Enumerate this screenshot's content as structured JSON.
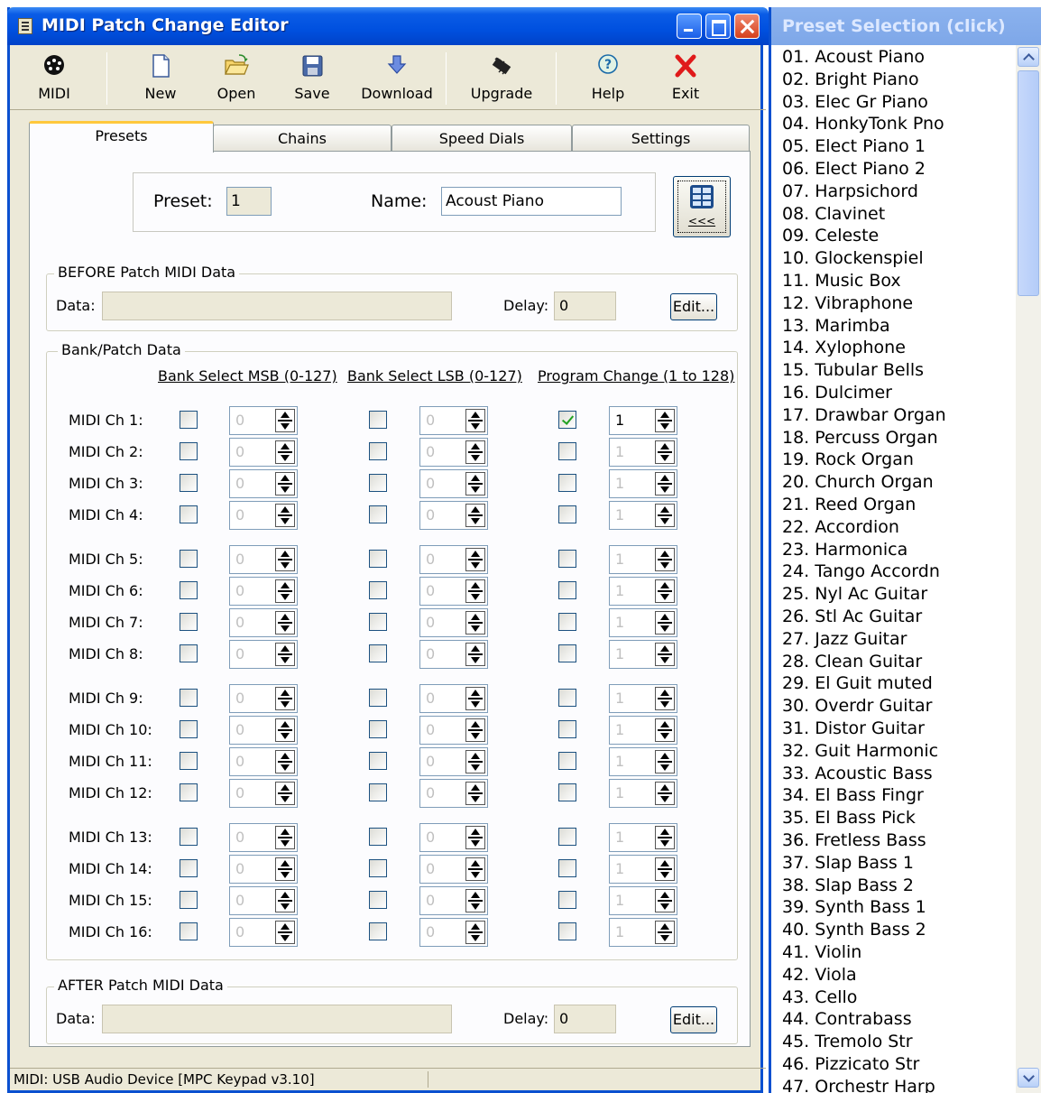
{
  "window": {
    "title": "MIDI Patch Change Editor"
  },
  "toolbar": {
    "midi_label": "MIDI",
    "new_label": "New",
    "open_label": "Open",
    "save_label": "Save",
    "download_label": "Download",
    "upgrade_label": "Upgrade",
    "help_label": "Help",
    "exit_label": "Exit"
  },
  "tabs": [
    {
      "label": "Presets",
      "active": true
    },
    {
      "label": "Chains"
    },
    {
      "label": "Speed Dials"
    },
    {
      "label": "Settings"
    }
  ],
  "preset": {
    "preset_label": "Preset:",
    "preset_value": "1",
    "name_label": "Name:",
    "name_value": "Acoust Piano",
    "grid_button_arrows": "<<<"
  },
  "before": {
    "title": "BEFORE Patch MIDI Data",
    "data_label": "Data:",
    "delay_label": "Delay:",
    "delay_value": "0",
    "edit_label": "Edit..."
  },
  "bank": {
    "title": "Bank/Patch Data",
    "msb_header": "Bank Select MSB (0-127)",
    "lsb_header": "Bank Select LSB (0-127)",
    "pc_header": "Program Change (1 to 128)"
  },
  "channels": [
    {
      "label": "MIDI Ch 1:",
      "msb": "0",
      "lsb": "0",
      "pc": "1",
      "pc_checked": true
    },
    {
      "label": "MIDI Ch 2:",
      "msb": "0",
      "lsb": "0",
      "pc": "1",
      "pc_checked": false
    },
    {
      "label": "MIDI Ch 3:",
      "msb": "0",
      "lsb": "0",
      "pc": "1",
      "pc_checked": false
    },
    {
      "label": "MIDI Ch 4:",
      "msb": "0",
      "lsb": "0",
      "pc": "1",
      "pc_checked": false
    },
    {
      "label": "MIDI Ch 5:",
      "msb": "0",
      "lsb": "0",
      "pc": "1",
      "pc_checked": false
    },
    {
      "label": "MIDI Ch 6:",
      "msb": "0",
      "lsb": "0",
      "pc": "1",
      "pc_checked": false
    },
    {
      "label": "MIDI Ch 7:",
      "msb": "0",
      "lsb": "0",
      "pc": "1",
      "pc_checked": false
    },
    {
      "label": "MIDI Ch 8:",
      "msb": "0",
      "lsb": "0",
      "pc": "1",
      "pc_checked": false
    },
    {
      "label": "MIDI Ch 9:",
      "msb": "0",
      "lsb": "0",
      "pc": "1",
      "pc_checked": false
    },
    {
      "label": "MIDI Ch 10:",
      "msb": "0",
      "lsb": "0",
      "pc": "1",
      "pc_checked": false
    },
    {
      "label": "MIDI Ch 11:",
      "msb": "0",
      "lsb": "0",
      "pc": "1",
      "pc_checked": false
    },
    {
      "label": "MIDI Ch 12:",
      "msb": "0",
      "lsb": "0",
      "pc": "1",
      "pc_checked": false
    },
    {
      "label": "MIDI Ch 13:",
      "msb": "0",
      "lsb": "0",
      "pc": "1",
      "pc_checked": false
    },
    {
      "label": "MIDI Ch 14:",
      "msb": "0",
      "lsb": "0",
      "pc": "1",
      "pc_checked": false
    },
    {
      "label": "MIDI Ch 15:",
      "msb": "0",
      "lsb": "0",
      "pc": "1",
      "pc_checked": false
    },
    {
      "label": "MIDI Ch 16:",
      "msb": "0",
      "lsb": "0",
      "pc": "1",
      "pc_checked": false
    }
  ],
  "after": {
    "title": "AFTER Patch MIDI Data",
    "data_label": "Data:",
    "delay_label": "Delay:",
    "delay_value": "0",
    "edit_label": "Edit..."
  },
  "status": {
    "text": "MIDI: USB Audio Device [MPC Keypad v3.10]"
  },
  "preset_panel": {
    "title": "Preset Selection (click)",
    "items": [
      "01. Acoust Piano",
      "02. Bright Piano",
      "03. Elec Gr Piano",
      "04. HonkyTonk Pno",
      "05. Elect Piano 1",
      "06. Elect Piano 2",
      "07. Harpsichord",
      "08. Clavinet",
      "09. Celeste",
      "10. Glockenspiel",
      "11. Music Box",
      "12. Vibraphone",
      "13. Marimba",
      "14. Xylophone",
      "15. Tubular Bells",
      "16. Dulcimer",
      "17. Drawbar Organ",
      "18. Percuss Organ",
      "19. Rock Organ",
      "20. Church Organ",
      "21. Reed Organ",
      "22. Accordion",
      "23. Harmonica",
      "24. Tango Accordn",
      "25. Nyl Ac Guitar",
      "26. Stl Ac Guitar",
      "27. Jazz Guitar",
      "28. Clean Guitar",
      "29. El Guit muted",
      "30. Overdr Guitar",
      "31. Distor Guitar",
      "32. Guit Harmonic",
      "33. Acoustic Bass",
      "34. El Bass Fingr",
      "35. El Bass Pick",
      "36. Fretless Bass",
      "37. Slap Bass 1",
      "38. Slap Bass 2",
      "39. Synth Bass 1",
      "40. Synth Bass 2",
      "41. Violin",
      "42. Viola",
      "43. Cello",
      "44. Contrabass",
      "45. Tremolo Str",
      "46. Pizzicato Str",
      "47. Orchestr Harp"
    ]
  },
  "colors": {
    "titlebar_blue": "#0050df",
    "window_bg": "#ece9d8",
    "check_green": "#21a121"
  }
}
